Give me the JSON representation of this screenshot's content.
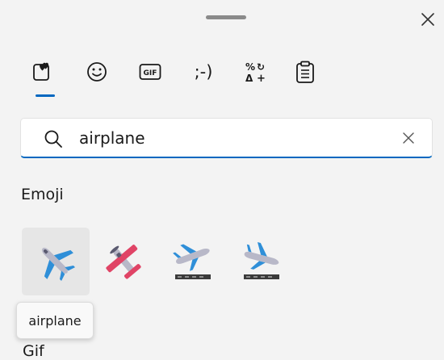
{
  "search": {
    "value": "airplane"
  },
  "tabs": [
    {
      "name": "favorites"
    },
    {
      "name": "emoji"
    },
    {
      "name": "gif",
      "label": "GIF"
    },
    {
      "name": "kaomoji",
      "label": ";-)"
    },
    {
      "name": "symbols"
    },
    {
      "name": "clipboard"
    }
  ],
  "active_tab": "favorites",
  "sections": {
    "emoji": "Emoji",
    "gif_partial": "Gif"
  },
  "emoji_results": [
    {
      "name": "airplane",
      "selected": true
    },
    {
      "name": "small airplane"
    },
    {
      "name": "airplane departure"
    },
    {
      "name": "airplane arrival"
    }
  ],
  "tooltip": "airplane",
  "colors": {
    "accent": "#0067c0",
    "plane_blue": "#2f8fd8",
    "plane_red": "#e04466"
  }
}
